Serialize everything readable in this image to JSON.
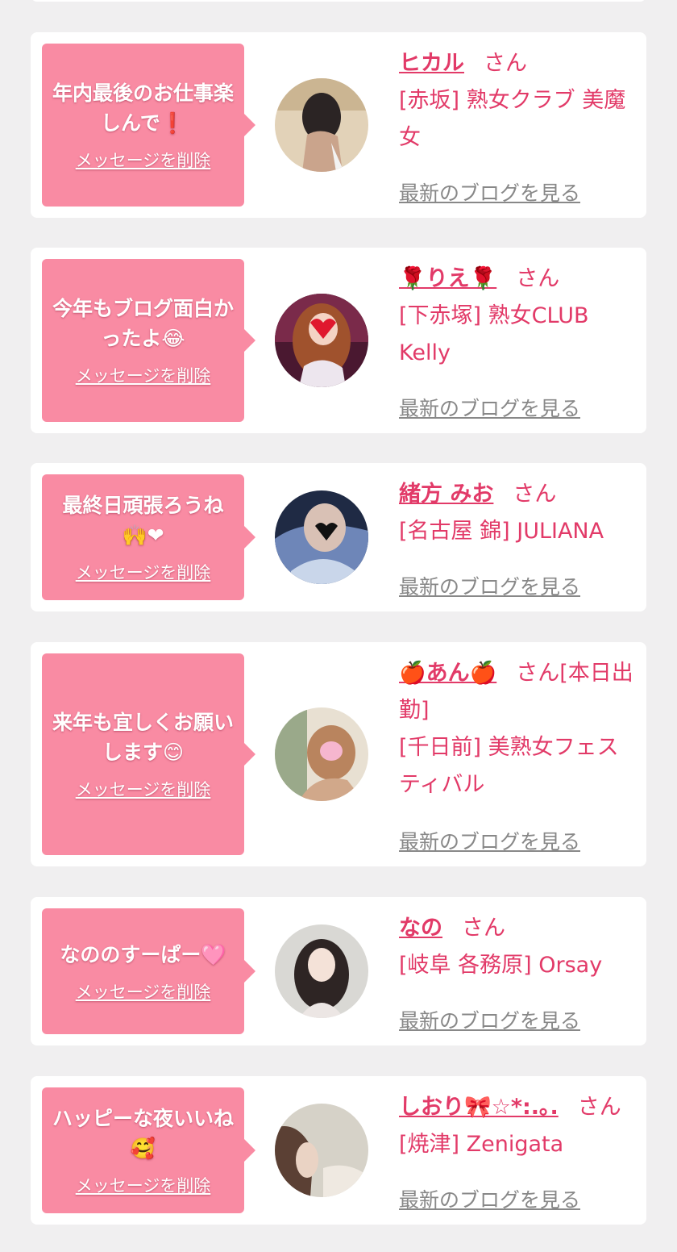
{
  "delete_label": "メッセージを削除",
  "blog_label": "最新のブログを見る",
  "san_label": "さん",
  "colors": {
    "bubble": "#f98ba3",
    "accent": "#e23a68",
    "muted": "#888888",
    "background": "#f0eff0"
  },
  "cards": [
    {
      "message": "年内最後のお仕事楽しんで❗",
      "name": "ヒカル",
      "suffix": "さん",
      "shop": "[赤坂] 熟女クラブ 美魔女"
    },
    {
      "message": "今年もブログ面白かったよ😂",
      "name": "🌹りえ🌹",
      "suffix": "さん",
      "shop": "[下赤塚] 熟女CLUB Kelly"
    },
    {
      "message": "最終日頑張ろうね🙌❤",
      "name": "緒方 みお",
      "suffix": "さん",
      "shop": "[名古屋 錦] JULIANA"
    },
    {
      "message": "来年も宜しくお願いします😊",
      "name": "🍎あん🍎",
      "suffix": "さん[本日出勤]",
      "shop": "[千日前] 美熟女フェスティバル"
    },
    {
      "message": "なののすーぱー🩷",
      "name": "なの",
      "suffix": "さん",
      "shop": "[岐阜 各務原] Orsay"
    },
    {
      "message": "ハッピーな夜いいね🥰",
      "name": "しおり🎀☆*:.｡.",
      "suffix": "さん",
      "shop": "[焼津] Zenigata"
    }
  ]
}
